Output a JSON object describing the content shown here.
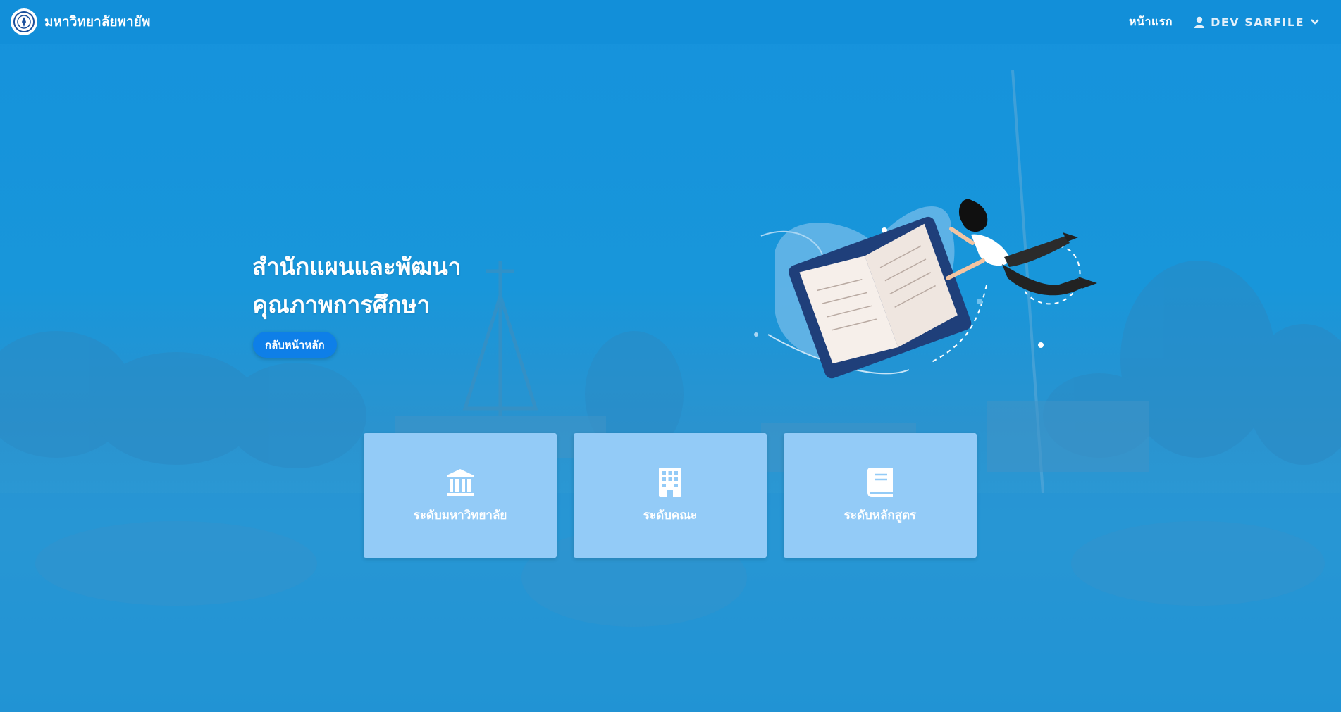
{
  "navbar": {
    "brand_name": "มหาวิทยาลัยพายัพ",
    "home_link": "หน้าแรก",
    "user_name": "DEV SARFILE"
  },
  "hero": {
    "title_line1": "สำนักแผนและพัฒนา",
    "title_line2": "คุณภาพการศึกษา",
    "back_button": "กลับหน้าหลัก"
  },
  "cards": [
    {
      "label": "ระดับมหาวิทยาลัย",
      "icon": "university-icon"
    },
    {
      "label": "ระดับคณะ",
      "icon": "building-icon"
    },
    {
      "label": "ระดับหลักสูตร",
      "icon": "book-icon"
    }
  ],
  "colors": {
    "background": "#1893d8",
    "card": "#93cbf7",
    "button": "#0e7fe8"
  }
}
